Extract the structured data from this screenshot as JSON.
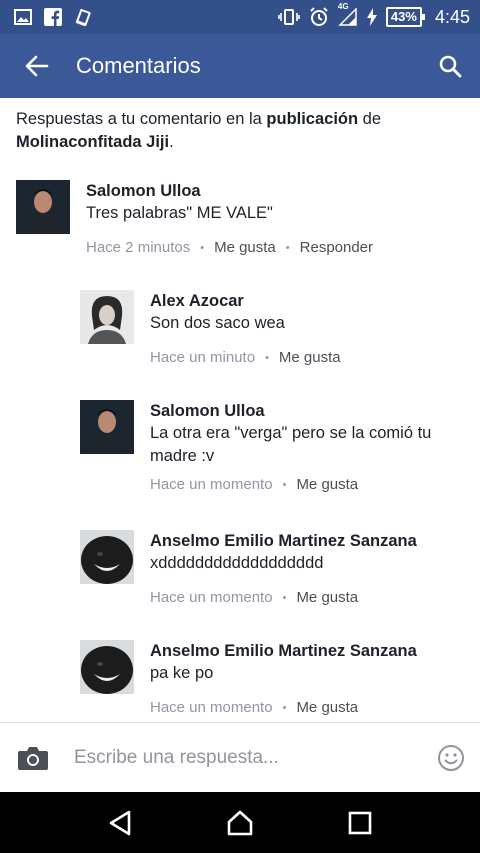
{
  "status_bar": {
    "battery": "43%",
    "time": "4:45",
    "network": "4G"
  },
  "app_bar": {
    "title": "Comentarios"
  },
  "intro": {
    "prefix": "Respuestas a tu comentario en la ",
    "link_word": "publicación",
    "middle": " de ",
    "author": "Molinaconfitada Jiji",
    "suffix": "."
  },
  "comments": [
    {
      "name": "Salomon Ulloa",
      "text": "Tres palabras\" ME VALE\"",
      "time": "Hace 2 minutos",
      "like": "Me gusta",
      "reply": "Responder"
    },
    {
      "name": "Alex Azocar",
      "text": "Son dos saco wea",
      "time": "Hace un minuto",
      "like": "Me gusta"
    },
    {
      "name": "Salomon Ulloa",
      "text": "La otra era \"verga\" pero se la comió tu madre :v",
      "time": "Hace un momento",
      "like": "Me gusta"
    },
    {
      "name": "Anselmo Emilio Martinez Sanzana",
      "text": "xdddddddddddddddddd",
      "time": "Hace un momento",
      "like": "Me gusta"
    },
    {
      "name": "Anselmo Emilio Martinez Sanzana",
      "text": "pa ke po",
      "time": "Hace un momento",
      "like": "Me gusta"
    }
  ],
  "composer": {
    "placeholder": "Escribe una respuesta..."
  },
  "icons": {
    "back": "arrow-left-icon",
    "search": "search-icon",
    "camera": "camera-icon",
    "emoji": "smiley-icon"
  },
  "colors": {
    "brand": "#3b5998",
    "status_bar": "#34508a",
    "meta_text": "#9197a3"
  }
}
